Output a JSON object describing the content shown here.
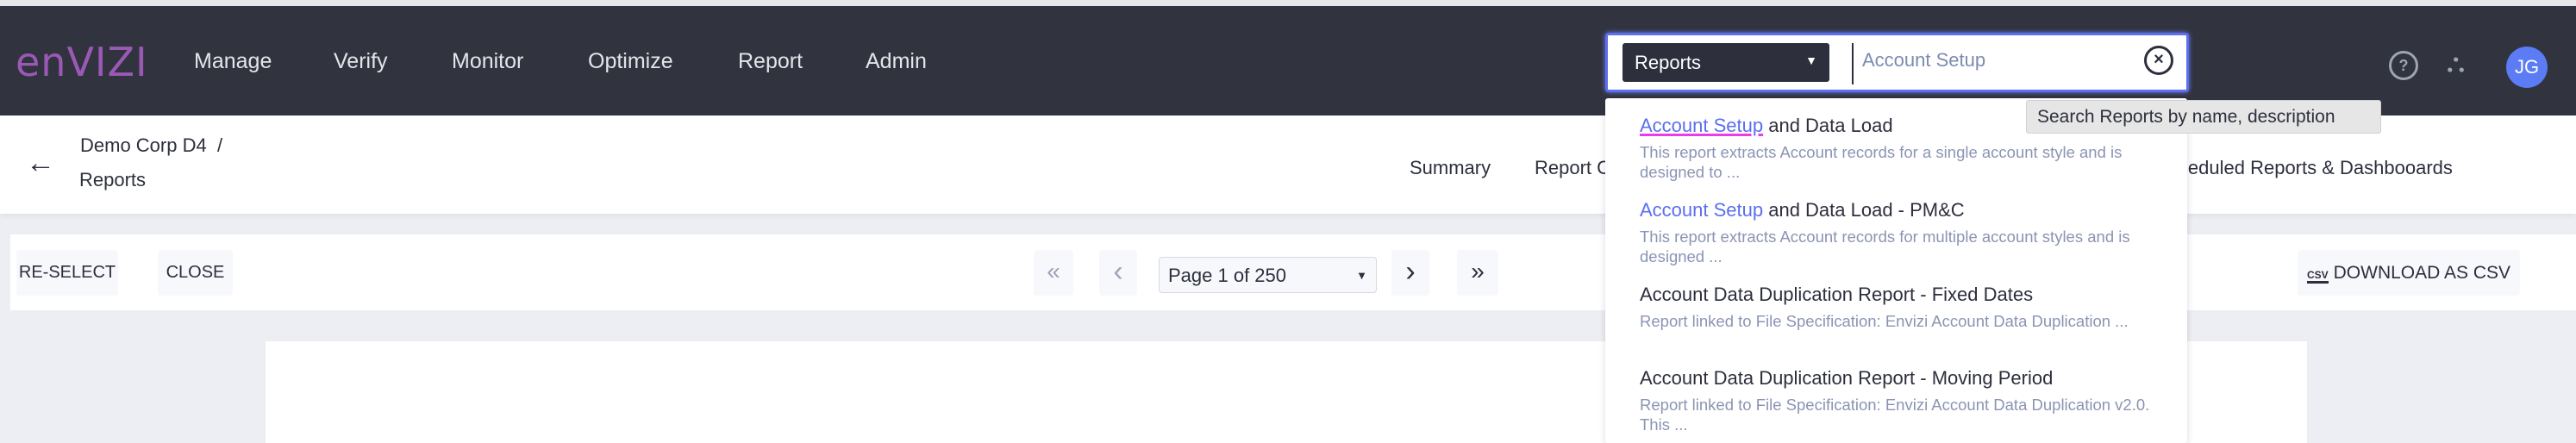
{
  "header": {
    "logo": "enVIZI",
    "nav": [
      "Manage",
      "Verify",
      "Monitor",
      "Optimize",
      "Report",
      "Admin"
    ],
    "search": {
      "scope": "Reports",
      "query": "Account Setup",
      "tooltip": "Search Reports by name, description"
    },
    "avatar_initials": "JG"
  },
  "breadcrumb": {
    "parent": "Demo Corp D4",
    "separator": "/",
    "current": "Reports"
  },
  "tabs": [
    "Summary",
    "Report C",
    "Scheduled Reports & Dashbooards"
  ],
  "toolbar": {
    "reselect": "RE-SELECT",
    "close": "CLOSE",
    "first": "«",
    "prev": "‹",
    "page": "Page 1 of 250",
    "next": "›",
    "last": "»",
    "download": "DOWNLOAD AS CSV",
    "csv_icon": "CSV"
  },
  "results": [
    {
      "match": "Account Setup",
      "rest": " and Data Load",
      "desc": "This report extracts Account records for a single account style and is designed to ..."
    },
    {
      "match": "Account Setup",
      "rest": " and Data Load - PM&C",
      "desc": "This report extracts Account records for multiple account styles and is designed ..."
    },
    {
      "match": "",
      "rest": "Account Data Duplication Report - Fixed Dates",
      "desc": "Report linked to File Specification: Envizi Account Data Duplication ..."
    },
    {
      "match": "",
      "rest": "Account Data Duplication Report - Moving Period",
      "desc": "Report linked to File Specification: Envizi Account Data Duplication v2.0. This ..."
    }
  ],
  "colors": {
    "header": "#31333f",
    "accent": "#5b6ff0",
    "brand": "#9b59b6"
  }
}
